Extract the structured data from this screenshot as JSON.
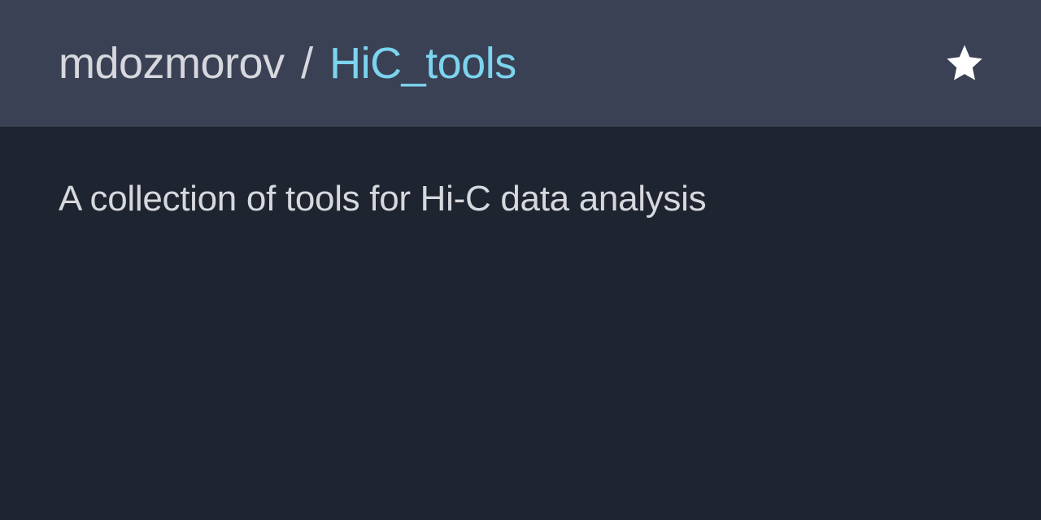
{
  "header": {
    "owner": "mdozmorov",
    "separator": "/",
    "repo": "HiC_tools"
  },
  "content": {
    "description": "A collection of tools for Hi-C data analysis"
  }
}
